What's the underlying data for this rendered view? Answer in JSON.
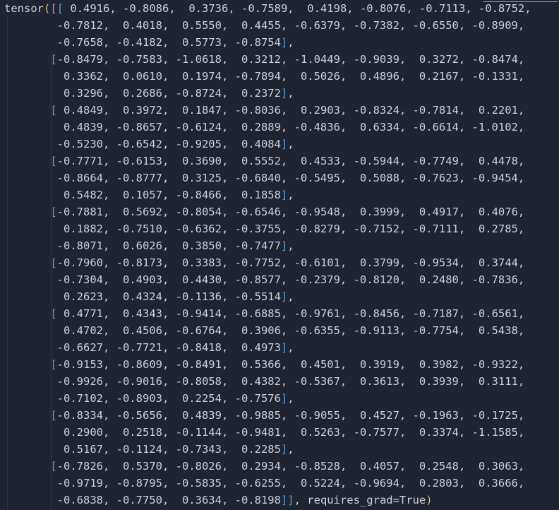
{
  "lines": [
    {
      "text": "tensor([[ 0.4916, -0.8086,  0.3736, -0.7589,  0.4198, -0.8076, -0.7113, -0.8752,"
    },
    {
      "text": "        -0.7812,  0.4018,  0.5550,  0.4455, -0.6379, -0.7382, -0.6550, -0.8909,"
    },
    {
      "text": "        -0.7658, -0.4182,  0.5773, -0.8754],"
    },
    {
      "text": "       [-0.8479, -0.7583, -1.0618,  0.3212, -1.0449, -0.9039,  0.3272, -0.8474,"
    },
    {
      "text": "         0.3362,  0.0610,  0.1974, -0.7894,  0.5026,  0.4896,  0.2167, -0.1331,"
    },
    {
      "text": "         0.3296,  0.2686, -0.8724,  0.2372],"
    },
    {
      "text": "       [ 0.4849,  0.3972,  0.1847, -0.8036,  0.2903, -0.8324, -0.7814,  0.2201,"
    },
    {
      "text": "         0.4839, -0.8657, -0.6124,  0.2889, -0.4836,  0.6334, -0.6614, -1.0102,"
    },
    {
      "text": "        -0.5230, -0.6542, -0.9205,  0.4084],"
    },
    {
      "text": "       [-0.7771, -0.6153,  0.3690,  0.5552,  0.4533, -0.5944, -0.7749,  0.4478,"
    },
    {
      "text": "        -0.8664, -0.8777,  0.3125, -0.6840, -0.5495,  0.5088, -0.7623, -0.9454,"
    },
    {
      "text": "         0.5482,  0.1057, -0.8466,  0.1858],"
    },
    {
      "text": "       [-0.7881,  0.5692, -0.8054, -0.6546, -0.9548,  0.3999,  0.4917,  0.4076,"
    },
    {
      "text": "         0.1882, -0.7510, -0.6362, -0.3755, -0.8279, -0.7152, -0.7111,  0.2785,"
    },
    {
      "text": "        -0.8071,  0.6026,  0.3850, -0.7477],"
    },
    {
      "text": "       [-0.7960, -0.8173,  0.3383, -0.7752, -0.6101,  0.3799, -0.9534,  0.3744,"
    },
    {
      "text": "        -0.7304,  0.4903,  0.4430, -0.8577, -0.2379, -0.8120,  0.2480, -0.7836,"
    },
    {
      "text": "         0.2623,  0.4324, -0.1136, -0.5514],"
    },
    {
      "text": "       [ 0.4771,  0.4343, -0.9414, -0.6885, -0.9761, -0.8456, -0.7187, -0.6561,"
    },
    {
      "text": "         0.4702,  0.4506, -0.6764,  0.3906, -0.6355, -0.9113, -0.7754,  0.5438,"
    },
    {
      "text": "        -0.6627, -0.7721, -0.8418,  0.4973],"
    },
    {
      "text": "       [-0.9153, -0.8609, -0.8491,  0.5366,  0.4501,  0.3919,  0.3982, -0.9322,"
    },
    {
      "text": "        -0.9926, -0.9016, -0.8058,  0.4382, -0.5367,  0.3613,  0.3939,  0.3111,"
    },
    {
      "text": "        -0.7102, -0.8903,  0.2254, -0.7576],"
    },
    {
      "text": "       [-0.8334, -0.5656,  0.4839, -0.9885, -0.9055,  0.4527, -0.1963, -0.1725,"
    },
    {
      "text": "         0.2900,  0.2518, -0.1144, -0.9481,  0.5263, -0.7577,  0.3374, -1.1585,"
    },
    {
      "text": "         0.5167, -0.1124, -0.7343,  0.2285],"
    },
    {
      "text": "       [-0.7826,  0.5370, -0.8026,  0.2934, -0.8528,  0.4057,  0.2548,  0.3063,"
    },
    {
      "text": "        -0.9719, -0.8795, -0.5835, -0.6255,  0.5224, -0.9694,  0.2803,  0.3666,"
    },
    {
      "text": "        -0.6838, -0.7750,  0.3634, -0.8198]], requires_grad=True)"
    }
  ]
}
